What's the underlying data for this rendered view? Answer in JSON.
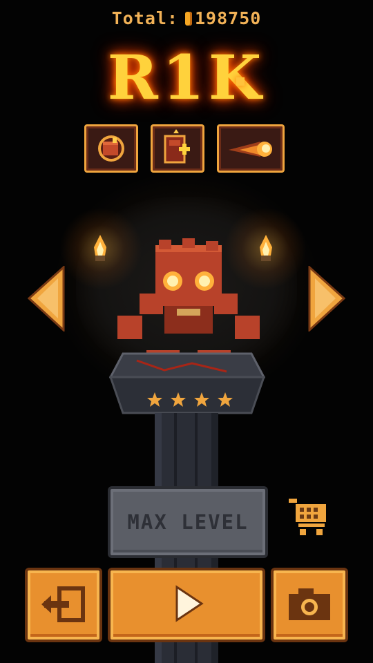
{
  "header": {
    "total_label": "Total:",
    "total_value": "198750",
    "coin_icon": "coin-icon"
  },
  "character": {
    "name": "R1K",
    "stars": 4,
    "abilities": [
      {
        "name": "fist-ability-icon"
      },
      {
        "name": "health-boost-ability-icon"
      },
      {
        "name": "fireball-ability-icon"
      }
    ]
  },
  "actions": {
    "max_level_label": "MAX LEVEL",
    "shop_icon": "shopping-cart-icon",
    "exit_icon": "exit-icon",
    "play_icon": "play-icon",
    "camera_icon": "camera-icon"
  },
  "colors": {
    "accent": "#e8902e",
    "title_glow": "#ffd23c",
    "gold_text": "#f2b257"
  }
}
